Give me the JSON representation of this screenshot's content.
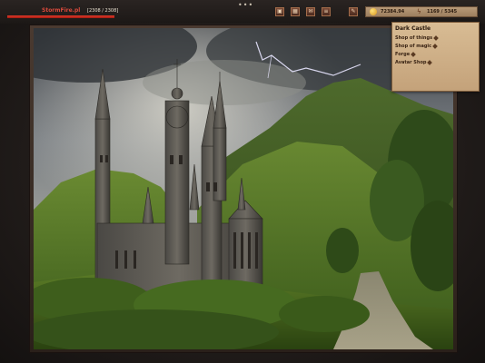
{
  "player": {
    "name": "StormFire.pl",
    "hp_text": "[2308 / 2308]",
    "hp_fraction": 1.0
  },
  "menu_dots": "•••",
  "toolbar": {
    "buttons": [
      {
        "name": "inventory-button",
        "icon": "bag-icon",
        "glyph": "▣"
      },
      {
        "name": "stats-button",
        "icon": "chart-icon",
        "glyph": "▦"
      },
      {
        "name": "mail-button",
        "icon": "envelope-icon",
        "glyph": "✉"
      },
      {
        "name": "quests-button",
        "icon": "scroll-icon",
        "glyph": "≡"
      },
      {
        "name": "edit-button",
        "icon": "pencil-icon",
        "glyph": "✎"
      }
    ]
  },
  "resources": {
    "gold": "72384.94",
    "energy": "1169 / 5345",
    "gold_icon": "coin-icon",
    "energy_icon": "lightning-icon"
  },
  "locations": {
    "title": "Dark Castle",
    "items": [
      "Shop of things",
      "Shop of magic",
      "Forge",
      "Avatar Shop"
    ]
  },
  "colors": {
    "accent_red": "#d84a3c",
    "panel_parchment": "#d8bc94"
  }
}
